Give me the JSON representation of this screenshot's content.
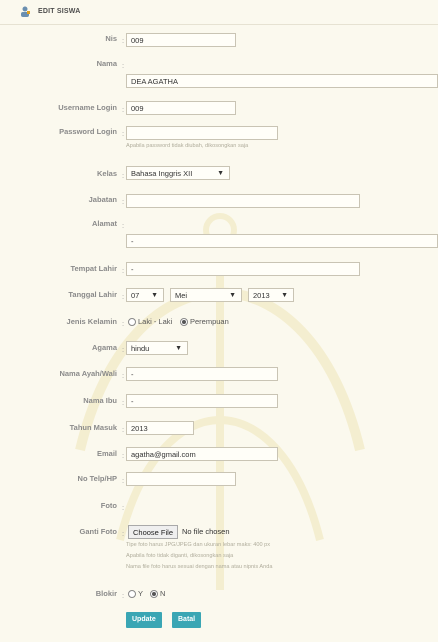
{
  "header": {
    "title": "EDIT SISWA",
    "icon": "user-edit-icon"
  },
  "fields": {
    "nis": {
      "label": "Nis",
      "value": "009"
    },
    "nama": {
      "label": "Nama",
      "value": "DEA AGATHA"
    },
    "username": {
      "label": "Username Login",
      "value": "009"
    },
    "password": {
      "label": "Password Login",
      "value": "",
      "hint": "Apabila password tidak diubah, dikosongkan saja"
    },
    "kelas": {
      "label": "Kelas",
      "value": "Bahasa Inggris XII"
    },
    "jabatan": {
      "label": "Jabatan",
      "value": ""
    },
    "alamat": {
      "label": "Alamat",
      "value": "-"
    },
    "tempat_lahir": {
      "label": "Tempat Lahir",
      "value": "-"
    },
    "tanggal_lahir": {
      "label": "Tanggal Lahir",
      "day": "07",
      "month": "Mei",
      "year": "2013"
    },
    "jenis_kelamin": {
      "label": "Jenis Kelamin",
      "options": [
        "Laki - Laki",
        "Perempuan"
      ],
      "selected": "Perempuan"
    },
    "agama": {
      "label": "Agama",
      "value": "hindu"
    },
    "nama_ayah": {
      "label": "Nama Ayah/Wali",
      "value": "-"
    },
    "nama_ibu": {
      "label": "Nama Ibu",
      "value": "-"
    },
    "tahun_masuk": {
      "label": "Tahun Masuk",
      "value": "2013"
    },
    "email": {
      "label": "Email",
      "value": "agatha@gmail.com"
    },
    "no_telp": {
      "label": "No Telp/HP",
      "value": ""
    },
    "foto": {
      "label": "Foto"
    },
    "ganti_foto": {
      "label": "Ganti Foto",
      "button": "Choose File",
      "status": "No file chosen",
      "hints": [
        "Tipe foto harus JPG/JPEG dan ukuran lebar maks: 400 px",
        "Apabila foto tidak diganti, dikosongkan saja",
        "Nama file foto harus sesuai dengan nama atau nipnis Anda"
      ]
    },
    "blokir": {
      "label": "Blokir",
      "options": [
        "Y",
        "N"
      ],
      "selected": "N"
    }
  },
  "colon": ":",
  "buttons": {
    "update": "Update",
    "batal": "Batal"
  },
  "colors": {
    "background": "#fbf9ee",
    "button": "#3aa6b4",
    "watermark": "#d8c23a"
  }
}
